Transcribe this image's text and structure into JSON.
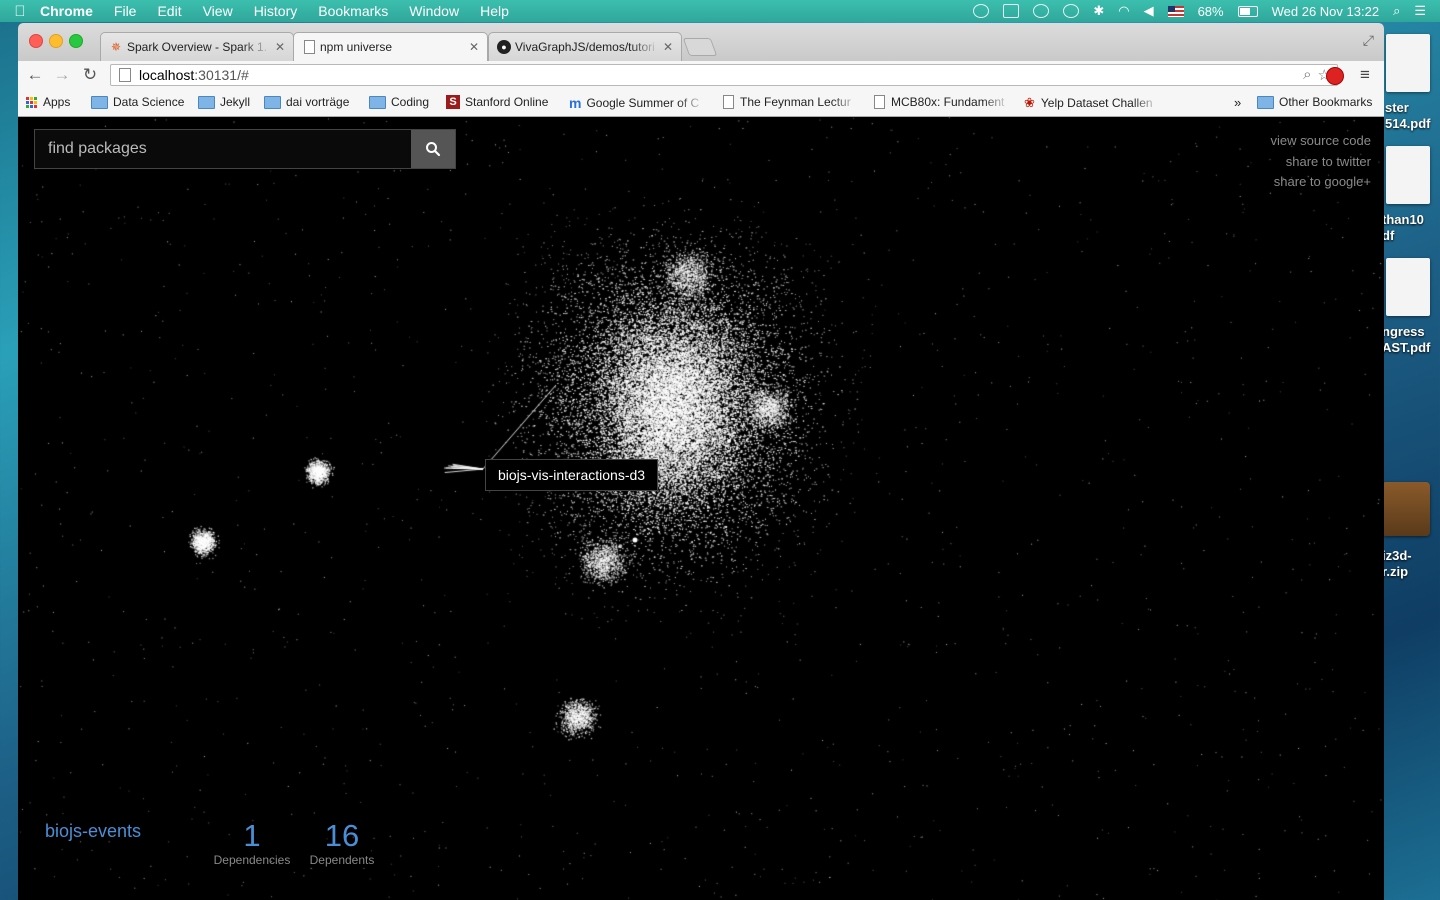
{
  "menubar": {
    "app": "Chrome",
    "items": [
      "File",
      "Edit",
      "View",
      "History",
      "Bookmarks",
      "Window",
      "Help"
    ],
    "battery": "68%",
    "datetime": "Wed 26 Nov  13:22"
  },
  "desktop": {
    "items": [
      "ster\n514.pdf",
      "than10\ndf",
      "ngress\nAST.pdf",
      "iz3d-\nr.zip"
    ]
  },
  "tabs": [
    {
      "title": "Spark Overview - Spark 1.",
      "active": false
    },
    {
      "title": "npm universe",
      "active": true
    },
    {
      "title": "VivaGraphJS/demos/tutori",
      "active": false
    }
  ],
  "address": {
    "host": "localhost",
    "rest": ":30131/#"
  },
  "bookmarks": {
    "apps": "Apps",
    "items": [
      {
        "label": "Data Science",
        "type": "folder"
      },
      {
        "label": "Jekyll",
        "type": "folder"
      },
      {
        "label": "dai vorträge",
        "type": "folder"
      },
      {
        "label": "Coding",
        "type": "folder"
      },
      {
        "label": "Stanford Online",
        "type": "stanford"
      },
      {
        "label": "Google Summer of C",
        "type": "google"
      },
      {
        "label": "The Feynman Lectur",
        "type": "page"
      },
      {
        "label": "MCB80x: Fundament",
        "type": "page"
      },
      {
        "label": "Yelp Dataset Challen",
        "type": "yelp"
      }
    ],
    "overflow": "»",
    "other": "Other Bookmarks"
  },
  "search": {
    "placeholder": "find packages"
  },
  "links": {
    "source": "view source code",
    "twitter": "share to twitter",
    "google": "share to google+"
  },
  "tooltip": "biojs-vis-interactions-d3",
  "selected": {
    "name": "biojs-events",
    "dependencies": {
      "value": "1",
      "label": "Dependencies"
    },
    "dependents": {
      "value": "16",
      "label": "Dependents"
    }
  }
}
